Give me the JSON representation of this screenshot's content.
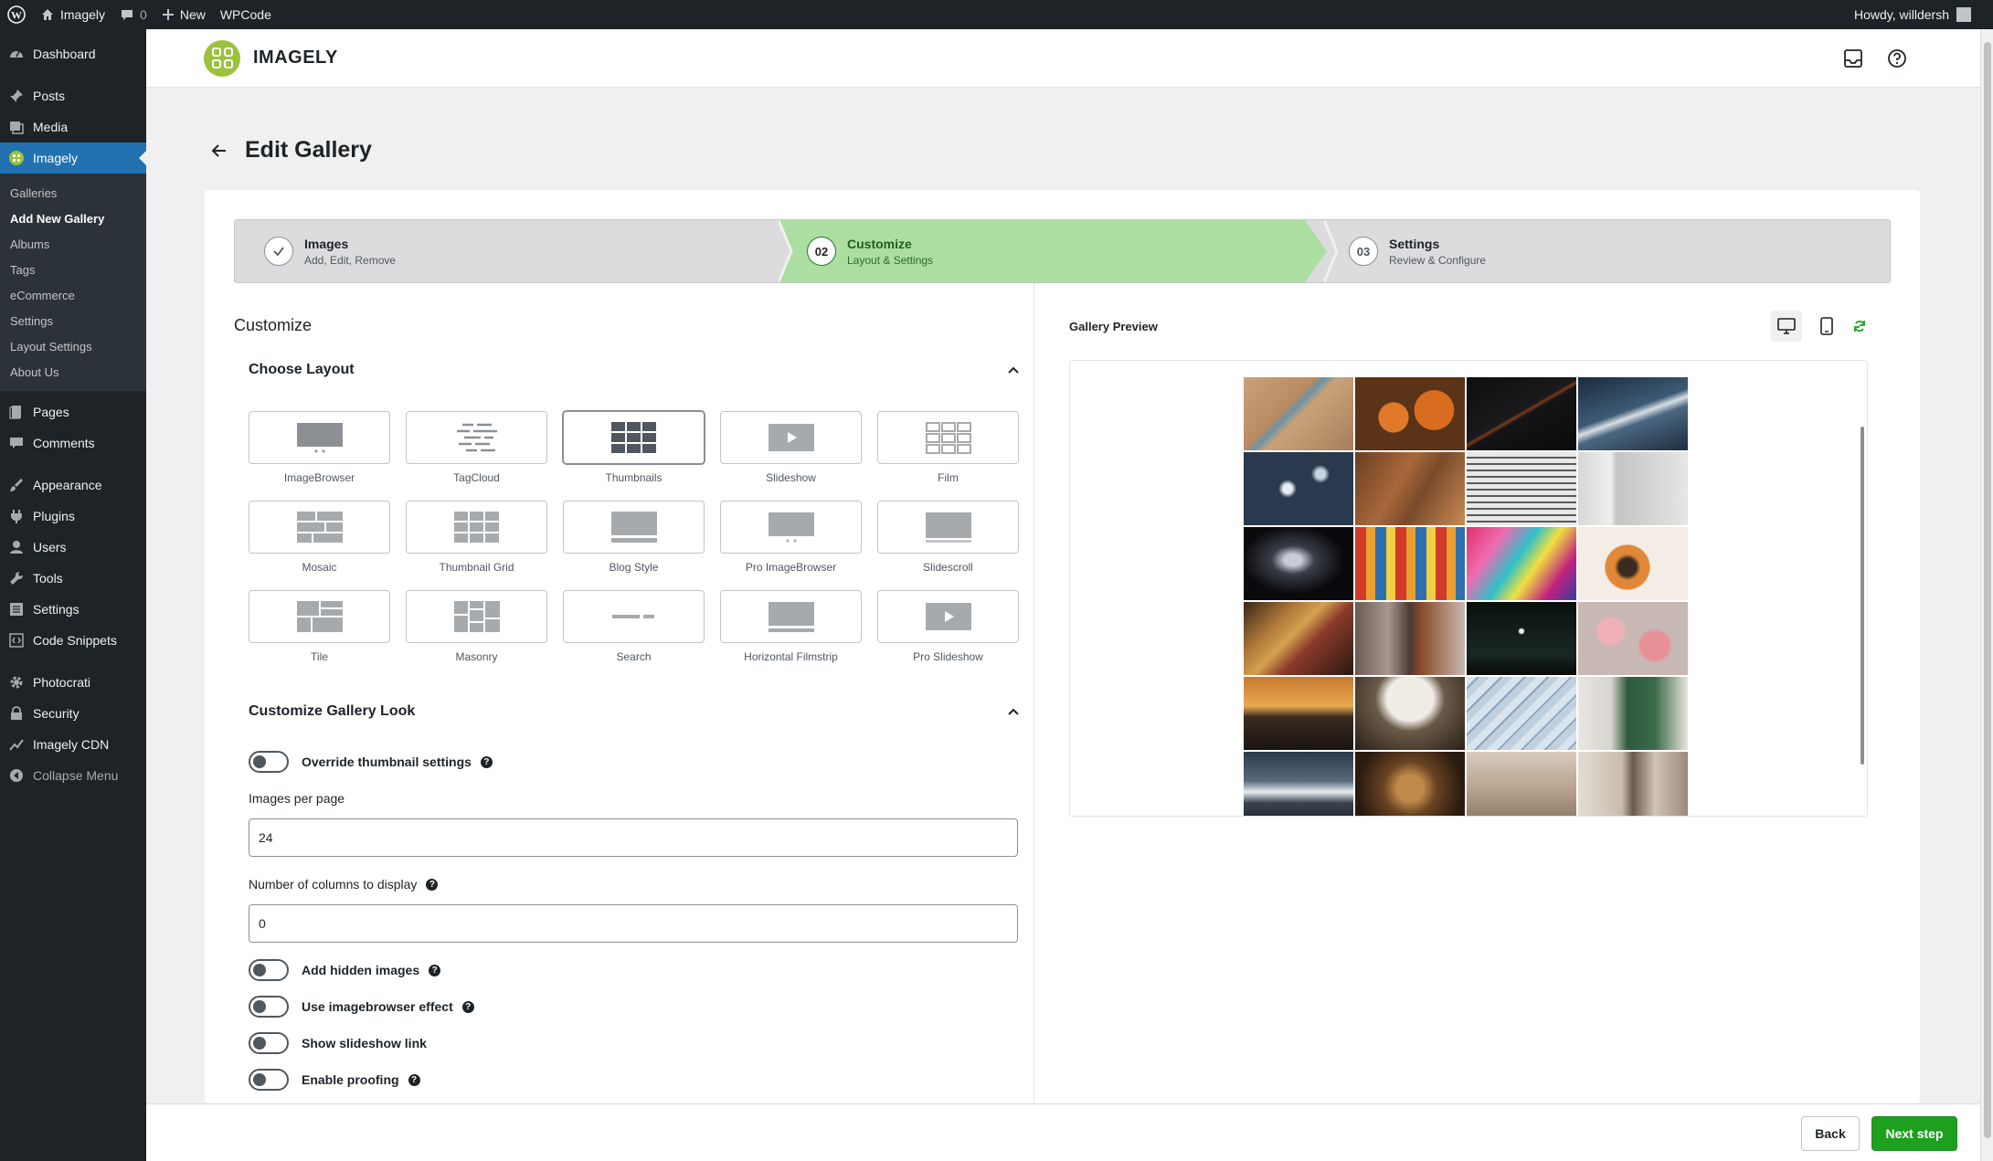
{
  "adminbar": {
    "site_name": "Imagely",
    "comments_count": "0",
    "new_label": "New",
    "wpcode_label": "WPCode",
    "howdy": "Howdy, willdersh"
  },
  "sidebar": {
    "items": [
      {
        "label": "Dashboard",
        "icon": "dashboard-icon"
      },
      {
        "label": "Posts",
        "icon": "pin-icon"
      },
      {
        "label": "Media",
        "icon": "media-icon"
      },
      {
        "label": "Imagely",
        "icon": "imagely-icon"
      },
      {
        "label": "Pages",
        "icon": "page-icon"
      },
      {
        "label": "Comments",
        "icon": "comment-icon"
      },
      {
        "label": "Appearance",
        "icon": "brush-icon"
      },
      {
        "label": "Plugins",
        "icon": "plugin-icon"
      },
      {
        "label": "Users",
        "icon": "user-icon"
      },
      {
        "label": "Tools",
        "icon": "wrench-icon"
      },
      {
        "label": "Settings",
        "icon": "settings-icon"
      },
      {
        "label": "Code Snippets",
        "icon": "code-icon"
      },
      {
        "label": "Photocrati",
        "icon": "gear-icon"
      },
      {
        "label": "Security",
        "icon": "lock-icon"
      },
      {
        "label": "Imagely CDN",
        "icon": "chart-icon"
      },
      {
        "label": "Collapse Menu",
        "icon": "collapse-icon"
      }
    ],
    "submenu": [
      "Galleries",
      "Add New Gallery",
      "Albums",
      "Tags",
      "eCommerce",
      "Settings",
      "Layout Settings",
      "About Us"
    ]
  },
  "header": {
    "brand": "IMAGELY"
  },
  "page": {
    "title": "Edit Gallery"
  },
  "stepper": [
    {
      "number": "",
      "title": "Images",
      "subtitle": "Add, Edit, Remove"
    },
    {
      "number": "02",
      "title": "Customize",
      "subtitle": "Layout & Settings"
    },
    {
      "number": "03",
      "title": "Settings",
      "subtitle": "Review & Configure"
    }
  ],
  "customize": {
    "heading": "Customize",
    "choose_layout": "Choose Layout",
    "layouts": [
      "ImageBrowser",
      "TagCloud",
      "Thumbnails",
      "Slideshow",
      "Film",
      "Mosaic",
      "Thumbnail Grid",
      "Blog Style",
      "Pro ImageBrowser",
      "Slidescroll",
      "Tile",
      "Masonry",
      "Search",
      "Horizontal Filmstrip",
      "Pro Slideshow"
    ],
    "selected_layout": "Thumbnails",
    "look_heading": "Customize Gallery Look",
    "override_label": "Override thumbnail settings",
    "images_per_page_label": "Images per page",
    "images_per_page_value": "24",
    "columns_label": "Number of columns to display",
    "columns_value": "0",
    "toggles": [
      "Add hidden images",
      "Use imagebrowser effect",
      "Show slideshow link",
      "Enable proofing"
    ]
  },
  "preview": {
    "title": "Gallery Preview",
    "colors": {
      "accent_green": "#1ea01e",
      "active_step": "#acdea2",
      "brand_logo": "#9bc23c"
    }
  },
  "footer": {
    "back_label": "Back",
    "next_label": "Next step"
  }
}
